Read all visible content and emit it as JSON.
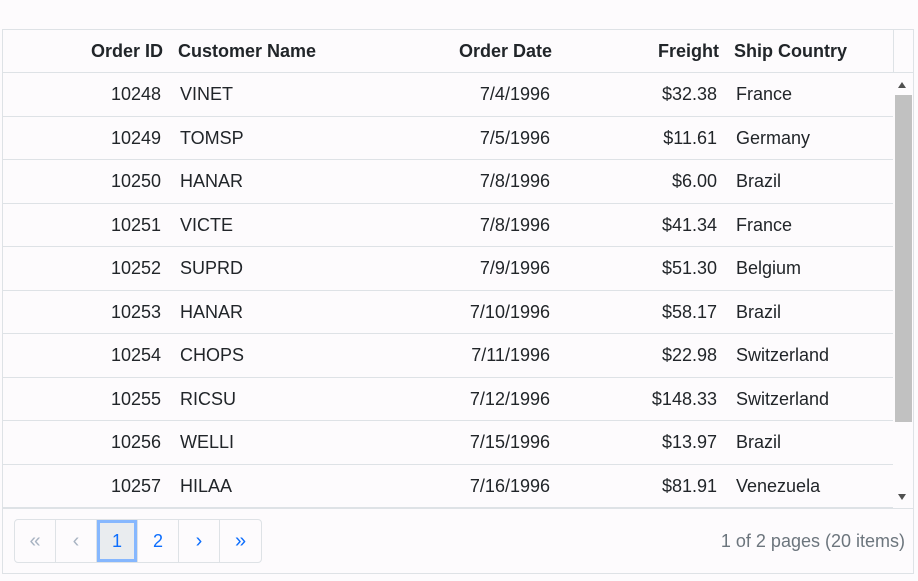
{
  "columns": {
    "order_id": "Order ID",
    "customer_name": "Customer Name",
    "order_date": "Order Date",
    "freight": "Freight",
    "ship_country": "Ship Country"
  },
  "rows": [
    {
      "order_id": "10248",
      "customer_name": "VINET",
      "order_date": "7/4/1996",
      "freight": "$32.38",
      "ship_country": "France"
    },
    {
      "order_id": "10249",
      "customer_name": "TOMSP",
      "order_date": "7/5/1996",
      "freight": "$11.61",
      "ship_country": "Germany"
    },
    {
      "order_id": "10250",
      "customer_name": "HANAR",
      "order_date": "7/8/1996",
      "freight": "$6.00",
      "ship_country": "Brazil"
    },
    {
      "order_id": "10251",
      "customer_name": "VICTE",
      "order_date": "7/8/1996",
      "freight": "$41.34",
      "ship_country": "France"
    },
    {
      "order_id": "10252",
      "customer_name": "SUPRD",
      "order_date": "7/9/1996",
      "freight": "$51.30",
      "ship_country": "Belgium"
    },
    {
      "order_id": "10253",
      "customer_name": "HANAR",
      "order_date": "7/10/1996",
      "freight": "$58.17",
      "ship_country": "Brazil"
    },
    {
      "order_id": "10254",
      "customer_name": "CHOPS",
      "order_date": "7/11/1996",
      "freight": "$22.98",
      "ship_country": "Switzerland"
    },
    {
      "order_id": "10255",
      "customer_name": "RICSU",
      "order_date": "7/12/1996",
      "freight": "$148.33",
      "ship_country": "Switzerland"
    },
    {
      "order_id": "10256",
      "customer_name": "WELLI",
      "order_date": "7/15/1996",
      "freight": "$13.97",
      "ship_country": "Brazil"
    },
    {
      "order_id": "10257",
      "customer_name": "HILAA",
      "order_date": "7/16/1996",
      "freight": "$81.91",
      "ship_country": "Venezuela"
    }
  ],
  "pager": {
    "first": "«",
    "prev": "‹",
    "pages": [
      "1",
      "2"
    ],
    "current_page": "1",
    "next": "›",
    "last": "»",
    "info": "1 of 2 pages (20 items)"
  },
  "colors": {
    "accent": "#0d6efd",
    "border": "#dee2e6",
    "background": "#fdfbfd",
    "scroll_thumb": "#c1c1c1"
  },
  "icons": {
    "scroll_up": "scroll-up-arrow-icon",
    "scroll_down": "scroll-down-arrow-icon"
  }
}
